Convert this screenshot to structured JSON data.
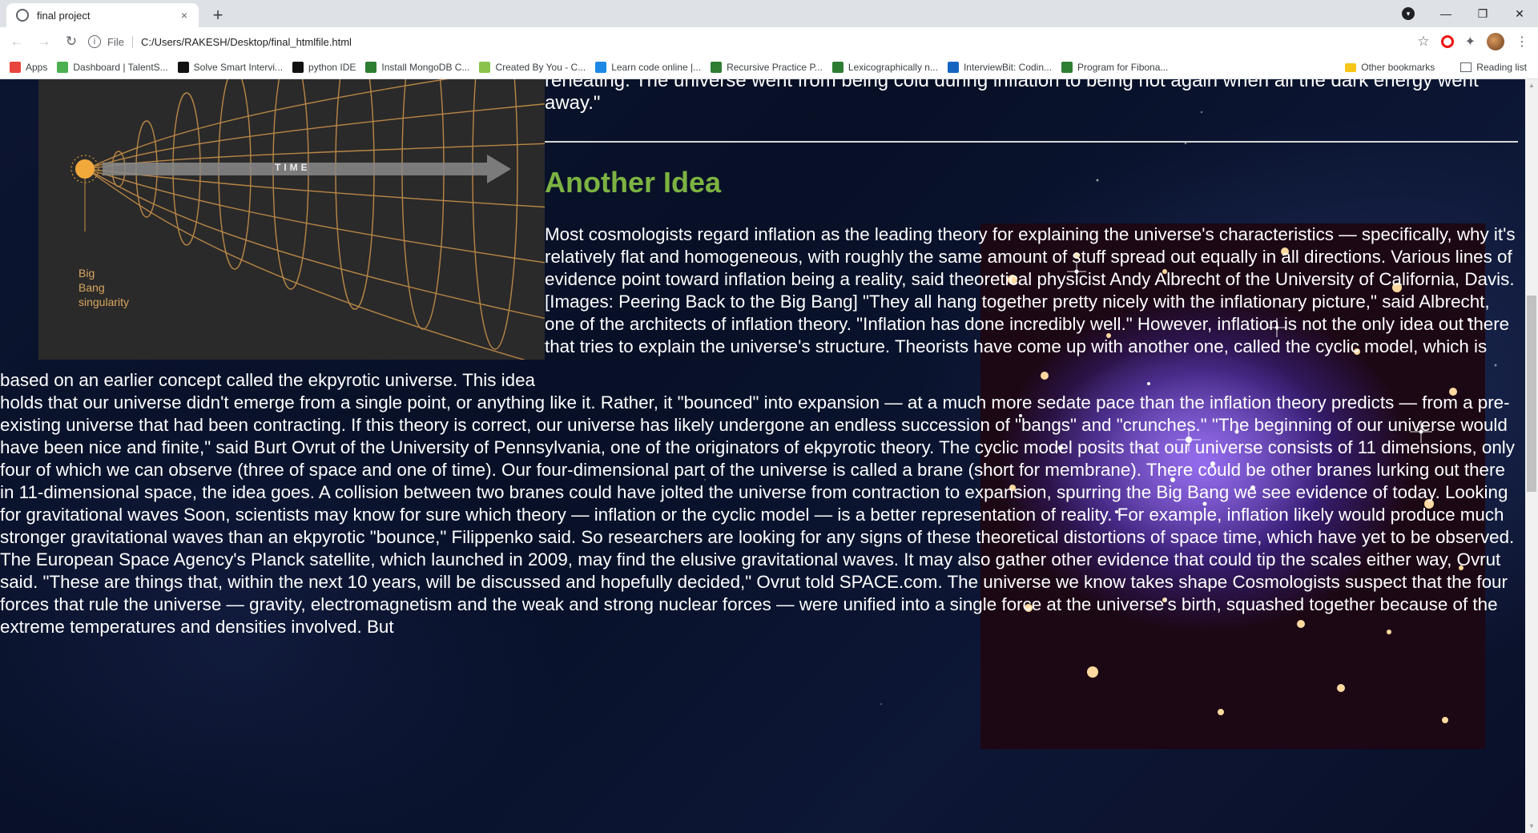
{
  "browser": {
    "tab_title": "final project",
    "tab_close": "×",
    "new_tab": "+",
    "file_label": "File",
    "url": "C:/Users/RAKESH/Desktop/final_htmlfile.html",
    "window_controls": {
      "minimize": "—",
      "restore": "❐",
      "close": "✕"
    },
    "bookmarks": [
      {
        "label": "Apps",
        "icon": "apps-grid-icon",
        "color": "#e8453c"
      },
      {
        "label": "Dashboard | TalentS...",
        "icon": "talent-icon",
        "color": "#4caf50"
      },
      {
        "label": "Solve Smart Intervi...",
        "icon": "interview-icon",
        "color": "#111111"
      },
      {
        "label": "python IDE",
        "icon": "python-icon",
        "color": "#111111"
      },
      {
        "label": "Install MongoDB C...",
        "icon": "mongodb-icon",
        "color": "#2e7d32"
      },
      {
        "label": "Created By You - C...",
        "icon": "codepen-icon",
        "color": "#8bc34a"
      },
      {
        "label": "Learn code online |...",
        "icon": "play-icon",
        "color": "#1e88e5"
      },
      {
        "label": "Recursive Practice P...",
        "icon": "gfg-icon",
        "color": "#2e7d32"
      },
      {
        "label": "Lexicographically n...",
        "icon": "gfg-icon",
        "color": "#2e7d32"
      },
      {
        "label": "InterviewBit: Codin...",
        "icon": "interviewbit-icon",
        "color": "#1565c0"
      },
      {
        "label": "Program for Fibona...",
        "icon": "gfg-icon",
        "color": "#2e7d32"
      }
    ],
    "other_bookmarks": "Other bookmarks",
    "reading_list": "Reading list"
  },
  "diagram": {
    "time_label": "TIME",
    "origin_label_1": "Big",
    "origin_label_2": "Bang",
    "origin_label_3": "singularity"
  },
  "page": {
    "top_quote": "reheating. The universe went from being cold during inflation to being hot again when all the dark energy went away.\"",
    "heading": "Another Idea",
    "body": "Most cosmologists regard inflation as the leading theory for explaining the universe's characteristics — specifically, why it's relatively flat and homogeneous, with roughly the same amount of stuff spread out equally in all directions. Various lines of evidence point toward inflation being a reality, said theoretical physicist Andy Albrecht of the University of California, Davis. [Images: Peering Back to the Big Bang] \"They all hang together pretty nicely with the inflationary picture,\" said Albrecht, one of the architects of inflation theory. \"Inflation has done incredibly well.\" However, inflation is not the only idea out there that tries to explain the universe's structure. Theorists have come up with another one, called the cyclic model, which is based on an earlier concept called the ekpyrotic universe. This idea holds that our universe didn't emerge from a single point, or anything like it. Rather, it \"bounced\" into expansion — at a much more sedate pace than the inflation theory predicts — from a pre-existing universe that had been contracting. If this theory is correct, our universe has likely undergone an endless succession of \"bangs\" and \"crunches.\" \"The beginning of our universe would have been nice and finite,\" said Burt Ovrut of the University of Pennsylvania, one of the originators of ekpyrotic theory. The cyclic model posits that our universe consists of 11 dimensions, only four of which we can observe (three of space and one of time). Our four-dimensional part of the universe is called a brane (short for membrane). There could be other branes lurking out there in 11-dimensional space, the idea goes. A collision between two branes could have jolted the universe from contraction to expansion, spurring the Big Bang we see evidence of today. Looking for gravitational waves Soon, scientists may know for sure which theory — inflation or the cyclic model — is a better representation of reality. For example, inflation likely would produce much stronger gravitational waves than an ekpyrotic \"bounce,\" Filippenko said. So researchers are looking for any signs of these theoretical distortions of space time, which have yet to be observed. The European Space Agency's Planck satellite, which launched in 2009, may find the elusive gravitational waves. It may also gather other evidence that could tip the scales either way, Ovrut said. \"These are things that, within the next 10 years, will be discussed and hopefully decided,\" Ovrut told SPACE.com. The universe we know takes shape Cosmologists suspect that the four forces that rule the universe — gravity, electromagnetism and the weak and strong nuclear forces — were unified into a single force at the universe's birth, squashed together because of the extreme temperatures and densities involved. But"
  },
  "colors": {
    "heading": "#7cb342",
    "page_background": "#0a0f24",
    "diagram_lines": "#c8924a"
  }
}
